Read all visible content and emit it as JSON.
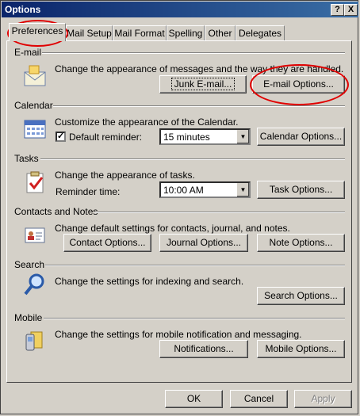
{
  "window": {
    "title": "Options",
    "help_label": "?",
    "close_label": "X"
  },
  "tabs": [
    {
      "label": "Preferences"
    },
    {
      "label": "Mail Setup"
    },
    {
      "label": "Mail Format"
    },
    {
      "label": "Spelling"
    },
    {
      "label": "Other"
    },
    {
      "label": "Delegates"
    }
  ],
  "email": {
    "title": "E-mail",
    "desc": "Change the appearance of messages and the way they are handled.",
    "junk_btn": "Junk E-mail...",
    "options_btn": "E-mail Options..."
  },
  "calendar": {
    "title": "Calendar",
    "desc": "Customize the appearance of the Calendar.",
    "reminder_label": "Default reminder:",
    "reminder_checked": true,
    "reminder_value": "15 minutes",
    "options_btn": "Calendar Options..."
  },
  "tasks": {
    "title": "Tasks",
    "desc": "Change the appearance of tasks.",
    "reminder_label": "Reminder time:",
    "reminder_value": "10:00 AM",
    "options_btn": "Task Options..."
  },
  "contacts": {
    "title": "Contacts and Notes",
    "desc": "Change default settings for contacts, journal, and notes.",
    "contact_btn": "Contact Options...",
    "journal_btn": "Journal Options...",
    "note_btn": "Note Options..."
  },
  "search": {
    "title": "Search",
    "desc": "Change the settings for indexing and search.",
    "options_btn": "Search Options..."
  },
  "mobile": {
    "title": "Mobile",
    "desc": "Change the settings for mobile notification and messaging.",
    "notifications_btn": "Notifications...",
    "options_btn": "Mobile Options..."
  },
  "footer": {
    "ok": "OK",
    "cancel": "Cancel",
    "apply": "Apply"
  },
  "annotation_color": "#e00000"
}
